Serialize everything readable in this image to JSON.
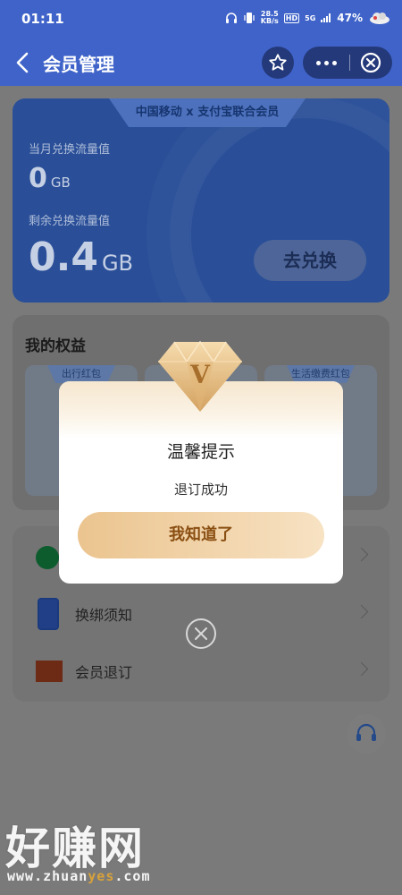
{
  "status_bar": {
    "time": "01:11",
    "net_speed_value": "28.5",
    "net_speed_unit": "KB/s",
    "hd": "HD",
    "signal": "5G",
    "battery": "47%"
  },
  "navbar": {
    "title": "会员管理"
  },
  "member_card": {
    "banner": "中国移动 x 支付宝联合会员",
    "month_label": "当月兑换流量值",
    "month_value": "0",
    "month_unit": "GB",
    "remaining_label": "剩余兑换流量值",
    "remaining_value": "0.4",
    "remaining_unit": "GB",
    "redeem_button": "去兑换"
  },
  "benefits": {
    "title": "我的权益",
    "cards": [
      {
        "tag": "出行红包"
      },
      {
        "tag": ""
      },
      {
        "tag": "生活缴费红包"
      }
    ]
  },
  "menu": {
    "items": [
      {
        "label": ""
      },
      {
        "label": "换绑须知"
      },
      {
        "label": "会员退订"
      }
    ]
  },
  "dialog": {
    "badge_letter": "V",
    "title": "温馨提示",
    "message": "退订成功",
    "confirm_button": "我知道了"
  },
  "watermark": {
    "title": "好赚网",
    "url_prefix": "www.zhuan",
    "url_accent": "yes",
    "url_suffix": ".com"
  },
  "colors": {
    "navbar": "#3f63c9",
    "card": "#2a4f98",
    "dialog_button": "#ebc48f",
    "dialog_button_text": "#8a4f13"
  }
}
